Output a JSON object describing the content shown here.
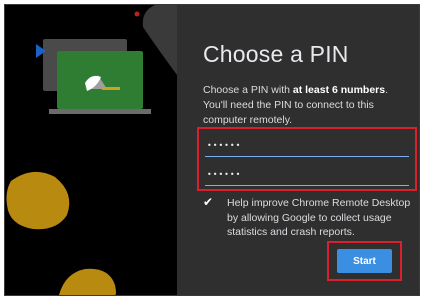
{
  "dialog": {
    "title": "Choose a PIN",
    "description_prefix": "Choose a PIN with ",
    "description_bold": "at least 6 numbers",
    "description_suffix": ". You'll need the PIN to connect to this computer remotely.",
    "pin_field": {
      "value": "••••••"
    },
    "confirm_field": {
      "value": "••••••"
    },
    "consent": {
      "checked": true,
      "check_glyph": "✔",
      "text": "Help improve Chrome Remote Desktop by allowing Google to collect usage statistics and crash reports."
    },
    "start_label": "Start"
  },
  "colors": {
    "accent": "#3b8fe3",
    "highlight": "#d9202c",
    "dialog_bg": "#2f2f2f",
    "art_bg": "#000000",
    "laptop_green": "#2e7d32",
    "blob_gold": "#b88a10",
    "arrow_blue": "#1a62c8",
    "dot_red": "#b3261e"
  },
  "icons": [
    "laptop-illustration-icon",
    "play-arrow-icon",
    "blob-decoration",
    "check-icon"
  ]
}
